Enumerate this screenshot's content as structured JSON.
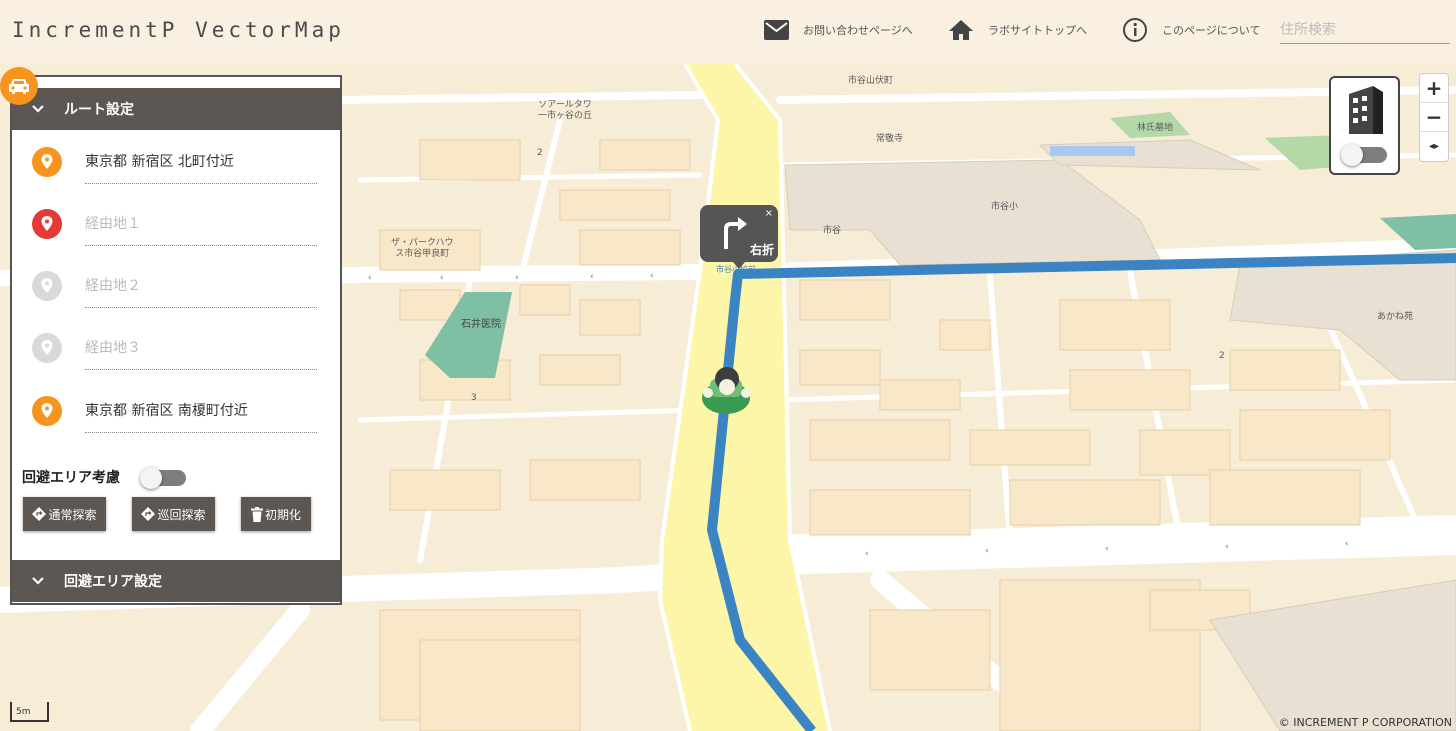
{
  "header": {
    "logo": "IncrementP VectorMap",
    "contact": "お問い合わせページへ",
    "lab_top": "ラボサイトトップへ",
    "about": "このページについて",
    "search_placeholder": "住所検索"
  },
  "route_panel": {
    "title": "ルート設定",
    "waypoints": [
      {
        "label": "東京都 新宿区 北町付近",
        "kind": "start",
        "filled": true
      },
      {
        "label": "経由地１",
        "kind": "via-active",
        "filled": false
      },
      {
        "label": "経由地２",
        "kind": "via",
        "filled": false
      },
      {
        "label": "経由地３",
        "kind": "via",
        "filled": false
      },
      {
        "label": "東京都 新宿区 南榎町付近",
        "kind": "goal",
        "filled": true
      }
    ],
    "avoid_area_label": "回避エリア考慮",
    "buttons": {
      "normal": "通常探索",
      "patrol": "巡回探索",
      "reset": "初期化"
    },
    "avoid_section_title": "回避エリア設定"
  },
  "turn_popup": {
    "label": "右折",
    "close": "×"
  },
  "map_labels": {
    "tower": "ソアールタワ\n一市ヶ谷の丘",
    "park_house": "ザ・パークハウ\nス市谷甲良町",
    "hospital": "石井医院",
    "temple": "常敬寺",
    "school": "市谷小",
    "ichigaya": "市谷",
    "forest": "林氏墓地",
    "akane": "あかね苑",
    "fushimi": "市谷山伏町",
    "school_tag": "市谷小校前",
    "num2a": "2",
    "num2b": "2",
    "num3": "3"
  },
  "zoom": {
    "in": "+",
    "out": "−",
    "rotate": "◂▸"
  },
  "scale_label": "5m",
  "copyright": "© INCREMENT P CORPORATION",
  "colors": {
    "accent": "#f7941d",
    "route": "#3a84c4",
    "panel": "#5d5753",
    "via_active": "#e53935",
    "via_inactive": "#d9d9d9",
    "road_highlight": "#fdf6a8"
  }
}
